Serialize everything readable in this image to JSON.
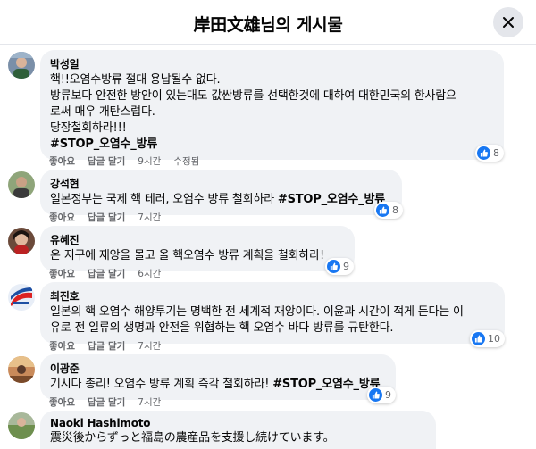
{
  "header": {
    "title": "岸田文雄님의 게시물"
  },
  "comments": [
    {
      "author": "박성일",
      "lines": [
        "핵!!오염수방류 절대 용납될수 없다.",
        "방류보다 안전한 방안이 있는대도 값싼방류를 선택한것에 대하여 대한민국의 한사람으",
        "로써 매우 개탄스럽다.",
        "당장철회하라!!!"
      ],
      "hashtag": "#STOP_오염수_방류",
      "actions": {
        "like": "좋아요",
        "reply": "답글 달기",
        "time": "9시간",
        "edited": "수정됨"
      },
      "reactions": "8"
    },
    {
      "author": "강석현",
      "text": "일본정부는 국제 핵 테러, 오염수 방류 철회하라 ",
      "hashtag": "#STOP_오염수_방류",
      "actions": {
        "like": "좋아요",
        "reply": "답글 달기",
        "time": "7시간"
      },
      "reactions": "8"
    },
    {
      "author": "유혜진",
      "text": "온 지구에 재앙을 몰고 올 핵오염수 방류 계획을 철회하라!",
      "actions": {
        "like": "좋아요",
        "reply": "답글 달기",
        "time": "6시간"
      },
      "reactions": "9"
    },
    {
      "author": "최진호",
      "lines": [
        "일본의 핵 오염수 해양투기는 명백한 전 세계적 재앙이다. 이윤과 시간이 적게 든다는 이",
        "유로 전 일류의 생명과 안전을 위협하는 핵 오염수 바다 방류를 규탄한다."
      ],
      "actions": {
        "like": "좋아요",
        "reply": "답글 달기",
        "time": "7시간"
      },
      "reactions": "10"
    },
    {
      "author": "이광준",
      "text": "기시다 총리! 오염수 방류 계획 즉각 철회하라! ",
      "hashtag": "#STOP_오염수_방류",
      "actions": {
        "like": "좋아요",
        "reply": "답글 달기",
        "time": "7시간"
      },
      "reactions": "9"
    },
    {
      "author": "Naoki Hashimoto",
      "text": "震災後からずっと福島の農産品を支援し続けています。"
    }
  ],
  "colors": {
    "like_blue": "#1877f2",
    "bubble": "#f0f2f5",
    "meta": "#65676b"
  }
}
